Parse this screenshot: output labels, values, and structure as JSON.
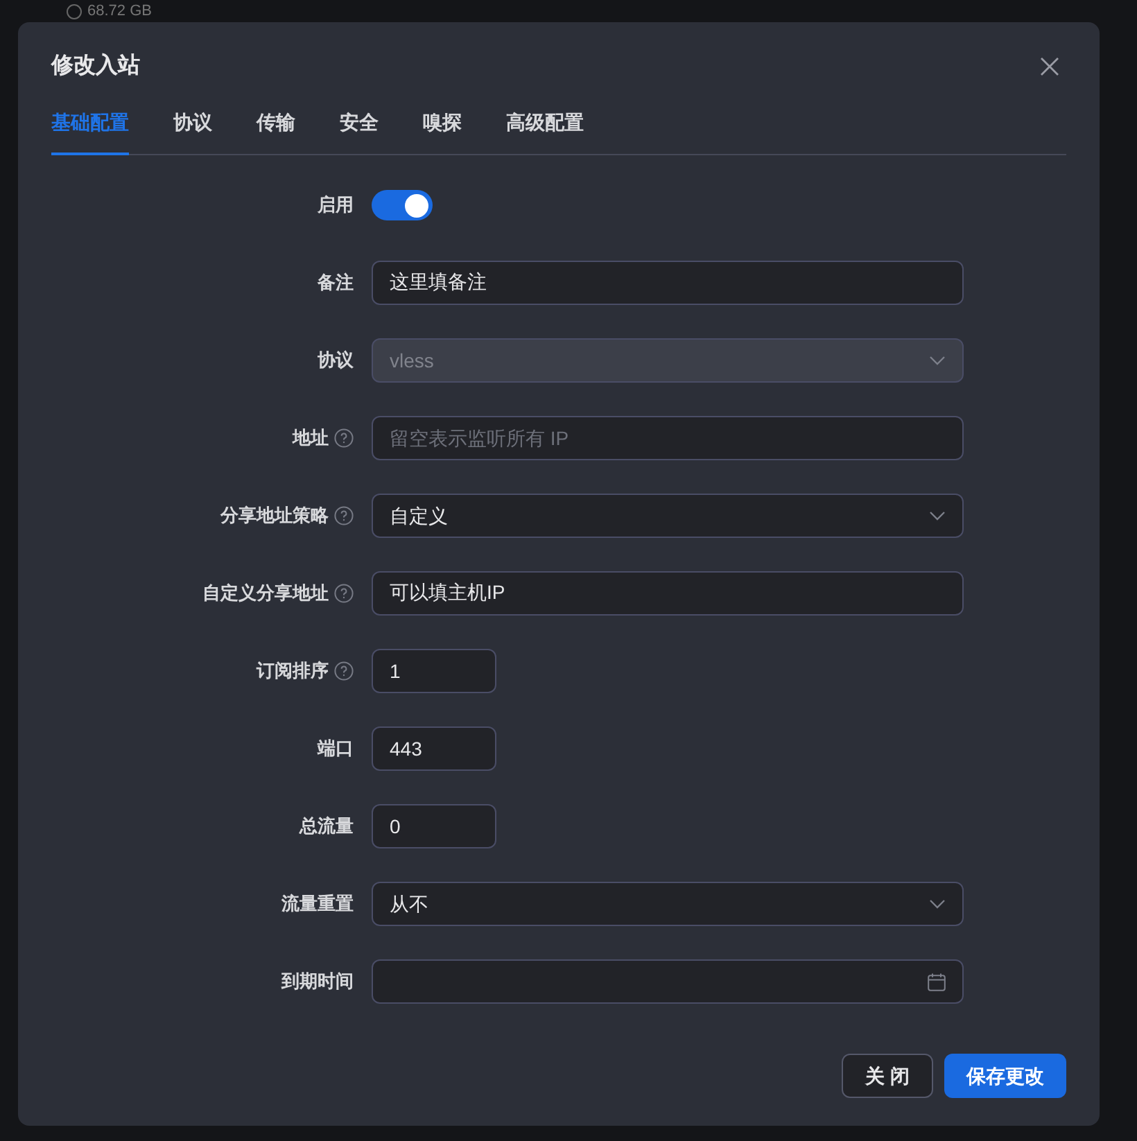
{
  "background": {
    "disk_usage": "68.72 GB"
  },
  "dialog": {
    "title": "修改入站",
    "tabs": [
      {
        "label": "基础配置",
        "selected": true
      },
      {
        "label": "协议",
        "selected": false
      },
      {
        "label": "传输",
        "selected": false
      },
      {
        "label": "安全",
        "selected": false
      },
      {
        "label": "嗅探",
        "selected": false
      },
      {
        "label": "高级配置",
        "selected": false
      }
    ],
    "fields": [
      {
        "kind": "switch",
        "label": "启用",
        "help": false,
        "on": true
      },
      {
        "kind": "text",
        "label": "备注",
        "help": false,
        "value": "这里填备注"
      },
      {
        "kind": "select",
        "label": "协议",
        "help": false,
        "value": "vless",
        "disabled": true
      },
      {
        "kind": "text",
        "label": "地址",
        "help": true,
        "placeholder": "留空表示监听所有 IP"
      },
      {
        "kind": "select",
        "label": "分享地址策略",
        "help": true,
        "value": "自定义",
        "disabled": false
      },
      {
        "kind": "text",
        "label": "自定义分享地址",
        "help": true,
        "value": "可以填主机IP"
      },
      {
        "kind": "number",
        "label": "订阅排序",
        "help": true,
        "value": "1"
      },
      {
        "kind": "number",
        "label": "端口",
        "help": false,
        "value": "443"
      },
      {
        "kind": "number",
        "label": "总流量",
        "help": false,
        "value": "0"
      },
      {
        "kind": "select",
        "label": "流量重置",
        "help": false,
        "value": "从不",
        "disabled": false
      },
      {
        "kind": "date",
        "label": "到期时间",
        "help": false
      }
    ],
    "buttons": [
      {
        "kind": "secondary",
        "label": "关 闭"
      },
      {
        "kind": "primary",
        "label": "保存更改"
      }
    ]
  }
}
